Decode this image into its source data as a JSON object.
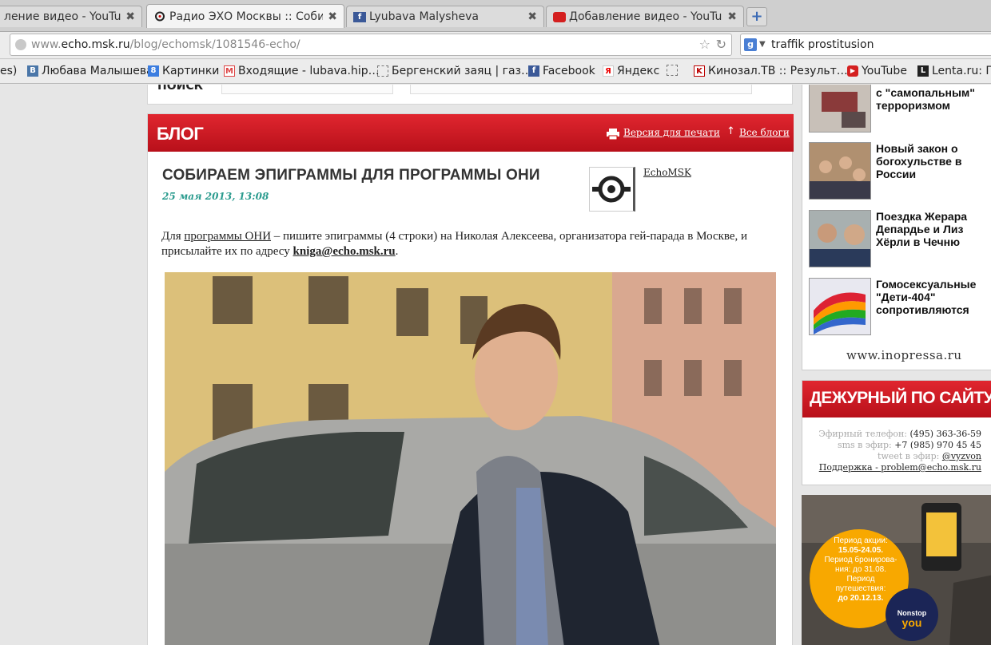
{
  "tabs": [
    {
      "title": "ление видео - YouTube",
      "close": "✖",
      "favicon": "none"
    },
    {
      "title": "Радио ЭХО Москвы :: Собир…",
      "close": "✖",
      "favicon": "echo"
    },
    {
      "title": "Lyubava Malysheva",
      "close": "✖",
      "favicon": "facebook"
    },
    {
      "title": "Добавление видео - YouTube",
      "close": "✖",
      "favicon": "youtube"
    }
  ],
  "new_tab": "+",
  "url": {
    "prefix": "www.",
    "host": "echo.msk.ru",
    "path": "/blog/echomsk/1081546-echo/"
  },
  "search": {
    "engine": "g",
    "query": "traffik prostitusion"
  },
  "bookmarks": [
    {
      "label": "es)",
      "icon": ""
    },
    {
      "label": "Любава Малышева",
      "icon": "В"
    },
    {
      "label": "Картинки",
      "icon": "8"
    },
    {
      "label": "Входящие - lubava.hip…",
      "icon": "M"
    },
    {
      "label": "Бергенский заяц | газ…",
      "icon": ""
    },
    {
      "label": "Facebook",
      "icon": "f"
    },
    {
      "label": "Яндекс",
      "icon": "Я"
    },
    {
      "label": "",
      "icon": ""
    },
    {
      "label": "Кинозал.ТВ :: Результ…",
      "icon": "K"
    },
    {
      "label": "YouTube",
      "icon": "▶"
    },
    {
      "label": "Lenta.ru: Гла",
      "icon": "L"
    }
  ],
  "page": {
    "search_label": "ПОИСК",
    "blog_label": "БЛОГ",
    "print_link": "Версия для печати",
    "all_blogs_link": "Все блоги",
    "post": {
      "title": "СОБИРАЕМ ЭПИГРАММЫ ДЛЯ ПРОГРАММЫ ОНИ",
      "date": "25 мая 2013, 13:08",
      "author": "EchoMSK",
      "body_pre": "Для ",
      "body_link": "программы ОНИ",
      "body_mid": " – пишите эпиграммы (4 строки) на Николая Алексеева, организатора гей-парада в Москве, и присылайте их по адресу ",
      "body_email": "kniga@echo.msk.ru",
      "body_end": "."
    }
  },
  "right": {
    "news": [
      {
        "title": "с \"самопальным\" терроризмом"
      },
      {
        "title": "Новый закон о богохульстве в России"
      },
      {
        "title": "Поездка Жерара Депардье и Лиз Хёрли в Чечню"
      },
      {
        "title": "Гомосексуальные \"Дети-404\" сопротивляются"
      }
    ],
    "news_source": "www.inopressa.ru",
    "duty": {
      "header": "ДЕЖУРНЫЙ ПО САЙТУ",
      "phone_label": "Эфирный телефон:",
      "phone": "(495) 363-36-59",
      "sms_label": "sms в эфир:",
      "sms": "+7 (985) 970 45 45",
      "tweet_label": "tweet в эфир:",
      "tweet": "@vyzvon",
      "support": "Поддержка - problem@echo.msk.ru"
    },
    "ad": {
      "line1": "Период акции:",
      "line2": "15.05-24.05.",
      "line3": "Период бронирова-",
      "line4": "ния: до 31.08.",
      "line5": "Период путешествия:",
      "line6": "до 20.12.13.",
      "brand1": "Nonstop",
      "brand2": "you"
    }
  }
}
